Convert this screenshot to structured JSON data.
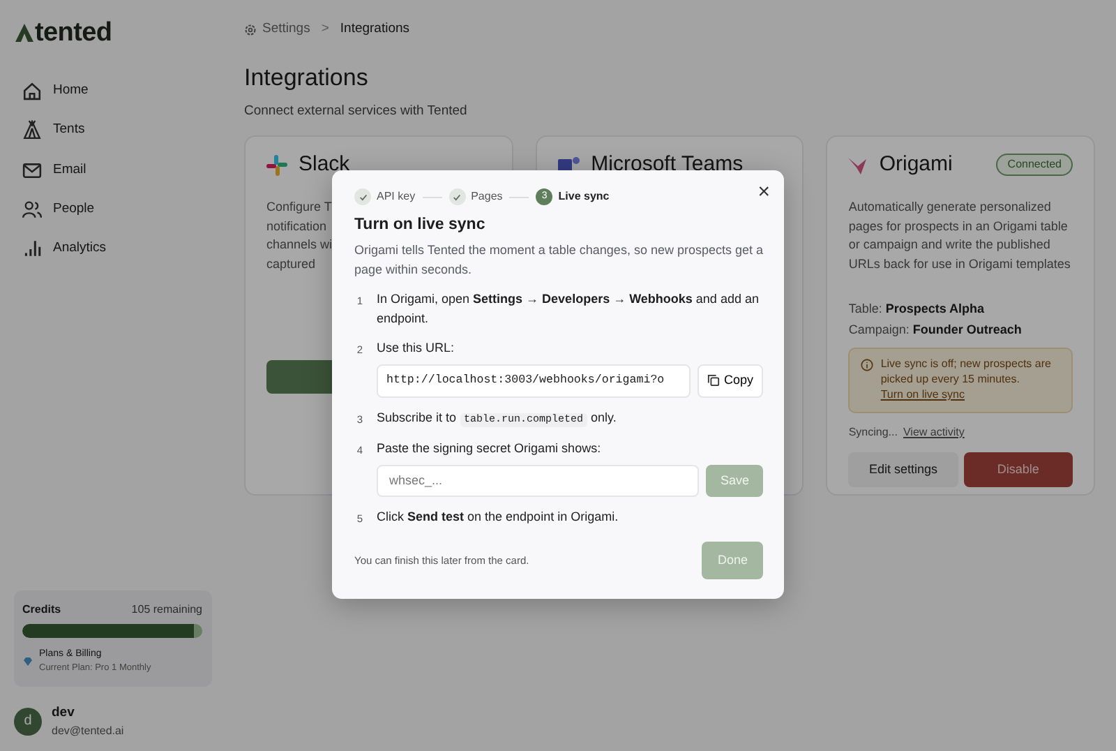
{
  "brand": {
    "name": "tented"
  },
  "nav": [
    {
      "label": "Home"
    },
    {
      "label": "Tents"
    },
    {
      "label": "Email"
    },
    {
      "label": "People"
    },
    {
      "label": "Analytics"
    }
  ],
  "credits": {
    "label": "Credits",
    "remaining": "105 remaining",
    "level": 0.95,
    "plan_title": "Plans & Billing",
    "plan": "Current Plan: Pro 1 Monthly"
  },
  "user": {
    "initial": "d",
    "name": "dev",
    "email": "dev@tented.ai"
  },
  "breadcrumb": [
    "Settings",
    "Integrations"
  ],
  "breadcrumb_separator": ">",
  "page": {
    "title": "Integrations",
    "subtitle": "Connect external services with Tented"
  },
  "cards": [
    {
      "kind": "slack",
      "title": "Slack",
      "lines": [
        "Configure T",
        "notification",
        "channels wi",
        "captured"
      ]
    },
    {
      "kind": "teams",
      "title": "Microsoft Teams"
    },
    {
      "kind": "origami",
      "title": "Origami",
      "badge": "Connected",
      "description": "Automatically generate personalized pages for prospects in an Origami table or campaign and write the published URLs back for use in Origami templates",
      "fields": [
        {
          "label": "Table:",
          "value": "Prospects Alpha"
        },
        {
          "label": "Campaign:",
          "value": "Founder Outreach"
        }
      ],
      "alert": {
        "text": "Live sync is off; new prospects are picked up every 15 minutes.",
        "link": "Turn on live sync"
      },
      "status": "Syncing...",
      "status_link": "View activity",
      "buttons": [
        {
          "label": "Edit settings",
          "kind": "light"
        },
        {
          "label": "Disable",
          "kind": "danger"
        }
      ]
    }
  ],
  "modal": {
    "close": "×",
    "steps": [
      {
        "label": "API key",
        "completed": true
      },
      {
        "label": "Pages",
        "completed": true
      },
      {
        "label": "Live sync",
        "number": "3",
        "completed": false
      }
    ],
    "title": "Turn on live sync",
    "intro": "Origami tells Tented the moment a table changes, so new prospects get a page within seconds.",
    "instructions": [
      {
        "number": "1",
        "kind": "text",
        "text": "In Origami, open **Settings → Developers → Webhooks** and add an endpoint."
      },
      {
        "number": "2",
        "kind": "url",
        "text": "Use this URL:",
        "value": "http://localhost:3003/webhooks/origami?o",
        "button": "Copy"
      },
      {
        "number": "3",
        "kind": "code",
        "text": "Subscribe it to",
        "code": "table.run.completed",
        "text_after": "only."
      },
      {
        "number": "4",
        "kind": "secret",
        "text": "Paste the signing secret Origami shows:",
        "placeholder": "whsec_...",
        "button": "Save",
        "disabled": true
      },
      {
        "number": "5",
        "kind": "text",
        "text": "Click **Send test** on the endpoint in Origami."
      }
    ],
    "footer_note": "You can finish this later from the card.",
    "done": "Done",
    "done_disabled": true
  }
}
